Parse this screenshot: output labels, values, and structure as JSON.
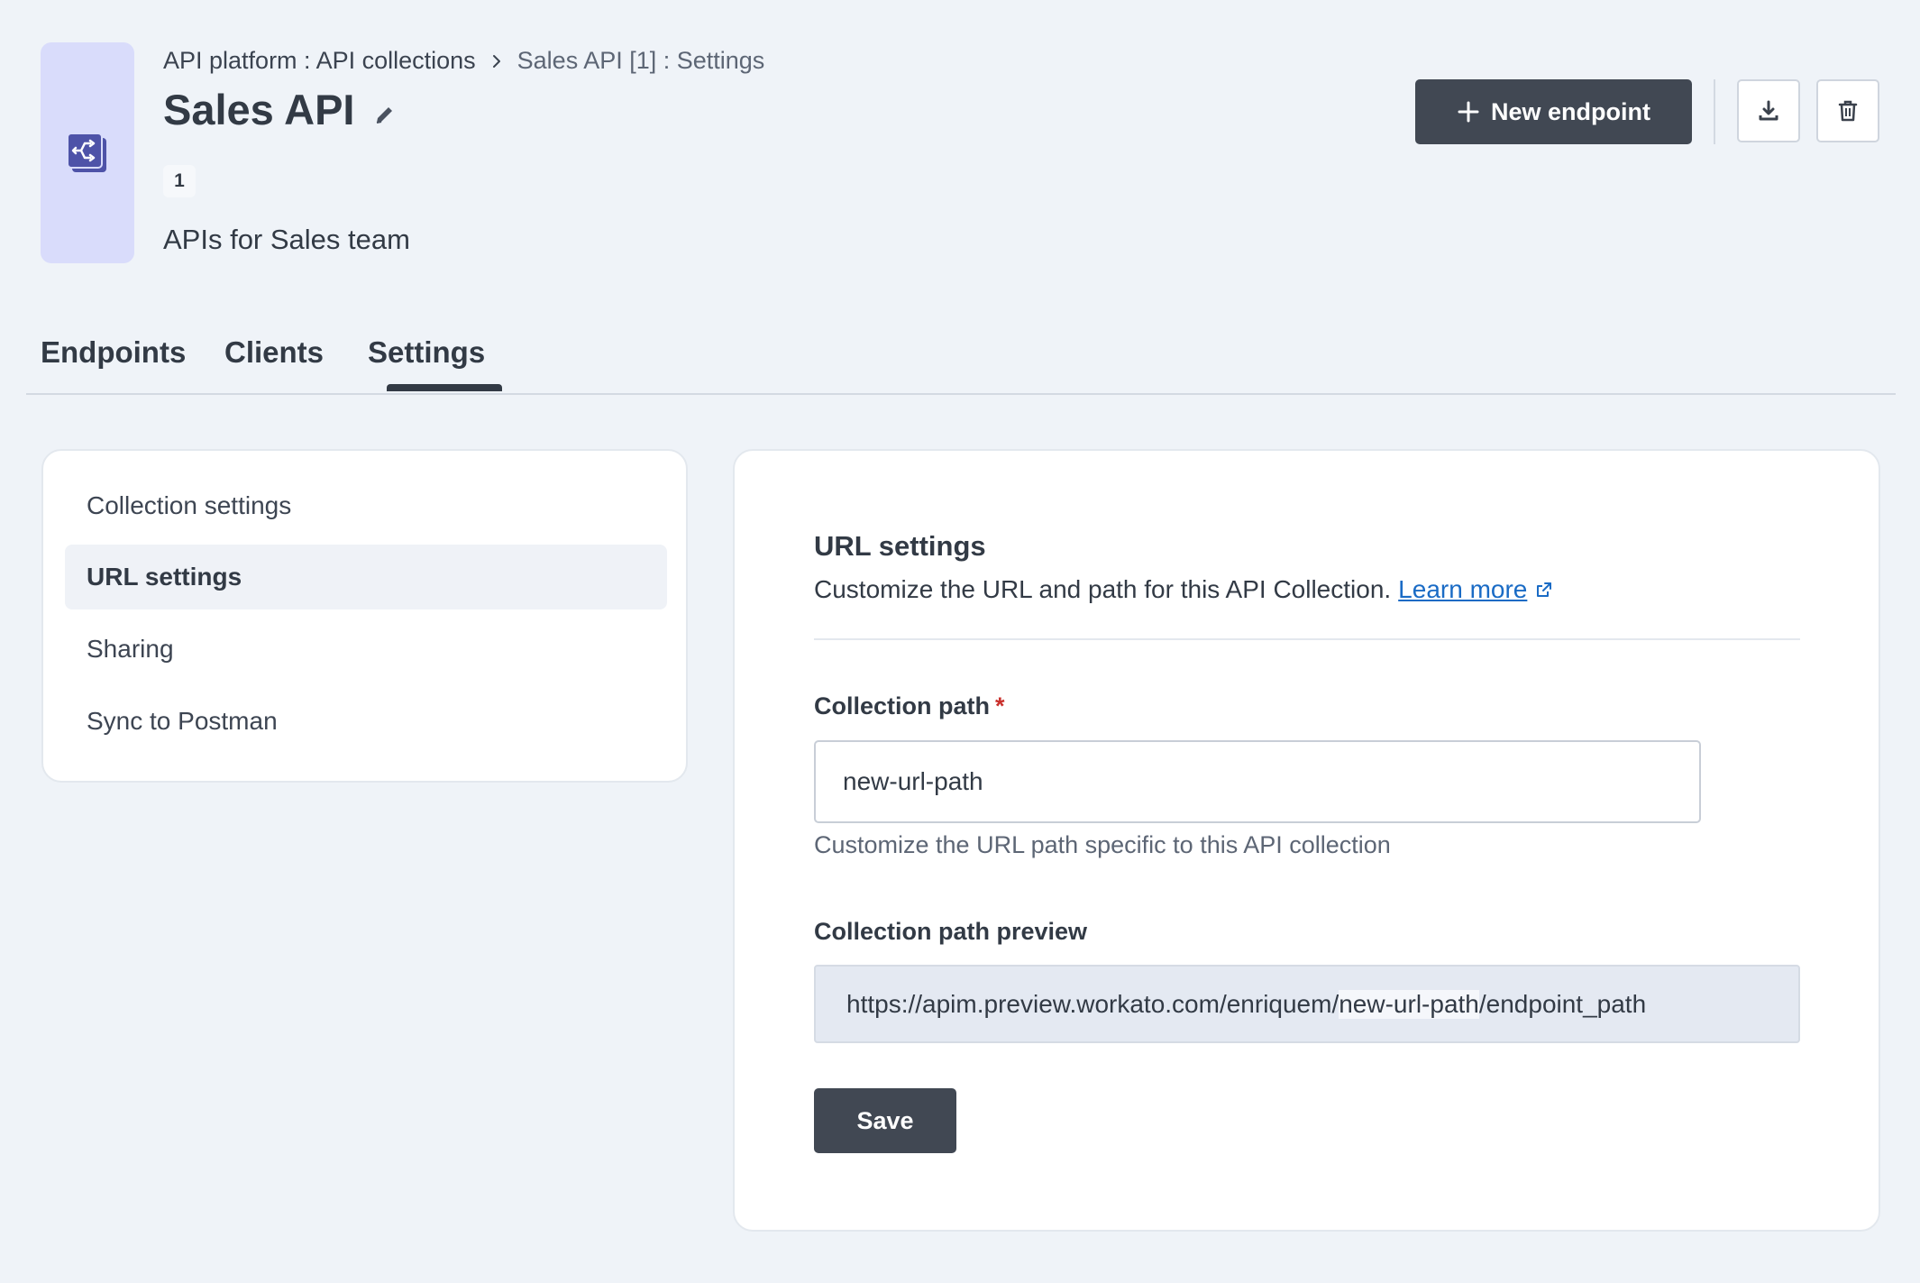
{
  "header": {
    "breadcrumb_parent": "API platform : API collections",
    "breadcrumb_current": "Sales API [1] : Settings",
    "title": "Sales API",
    "version": "1",
    "description": "APIs for Sales team",
    "new_endpoint_label": "New endpoint"
  },
  "tabs": [
    {
      "label": "Endpoints"
    },
    {
      "label": "Clients"
    },
    {
      "label": "Settings",
      "active": true
    }
  ],
  "sidebar": {
    "items": [
      {
        "label": "Collection settings"
      },
      {
        "label": "URL settings",
        "active": true
      },
      {
        "label": "Sharing"
      },
      {
        "label": "Sync to Postman"
      }
    ]
  },
  "url_settings": {
    "title": "URL settings",
    "description": "Customize the URL and path for this API Collection.",
    "learn_more": "Learn more",
    "collection_path_label": "Collection path",
    "required_mark": "*",
    "collection_path_value": "new-url-path",
    "collection_path_hint": "Customize the URL path specific to this API collection",
    "preview_label": "Collection path preview",
    "preview_prefix": "https://apim.preview.workato.com/enriquem/",
    "preview_highlight": "new-url-path",
    "preview_suffix": "/endpoint_path",
    "save_label": "Save"
  },
  "icons": {
    "collection": "api-collection-icon",
    "edit": "pencil-icon",
    "download": "download-icon",
    "delete": "trash-icon",
    "external": "external-link-icon"
  },
  "colors": {
    "primary_button": "#414853",
    "link": "#1a6bc5",
    "icon_box": "#d9dcfb",
    "required": "#c9302c"
  }
}
